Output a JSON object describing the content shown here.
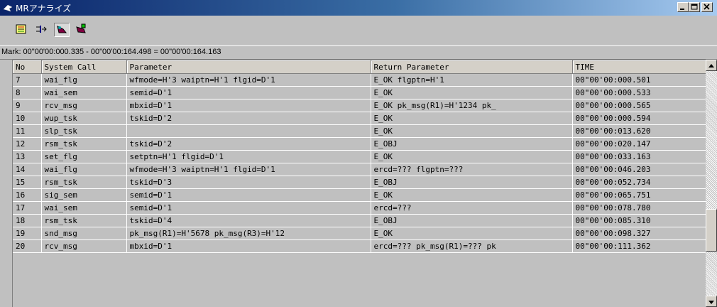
{
  "window": {
    "title": "MRアナライズ"
  },
  "toolbar": {
    "icons": [
      "trace-view-icon",
      "split-view-icon",
      "analyze-icon",
      "settings-icon"
    ]
  },
  "mark": {
    "text": "Mark: 00\"00'00:000.335 - 00\"00'00:164.498 = 00\"00'00:164.163"
  },
  "table": {
    "columns": [
      "No",
      "System Call",
      "Parameter",
      "Return Parameter",
      "TIME"
    ],
    "rows": [
      {
        "no": "7",
        "call": "wai_flg",
        "param": "wfmode=H'3   waiptn=H'1   flgid=D'1",
        "ret": "E_OK   flgptn=H'1",
        "time": "00\"00'00:000.501"
      },
      {
        "no": "8",
        "call": "wai_sem",
        "param": "semid=D'1",
        "ret": "E_OK",
        "time": "00\"00'00:000.533"
      },
      {
        "no": "9",
        "call": "rcv_msg",
        "param": "mbxid=D'1",
        "ret": "E_OK   pk_msg(R1)=H'1234   pk_",
        "time": "00\"00'00:000.565"
      },
      {
        "no": "10",
        "call": "wup_tsk",
        "param": "tskid=D'2",
        "ret": "E_OK",
        "time": "00\"00'00:000.594"
      },
      {
        "no": "11",
        "call": "slp_tsk",
        "param": "",
        "ret": "E_OK",
        "time": "00\"00'00:013.620"
      },
      {
        "no": "12",
        "call": "rsm_tsk",
        "param": "tskid=D'2",
        "ret": "E_OBJ",
        "time": "00\"00'00:020.147"
      },
      {
        "no": "13",
        "call": "set_flg",
        "param": "setptn=H'1   flgid=D'1",
        "ret": "E_OK",
        "time": "00\"00'00:033.163"
      },
      {
        "no": "14",
        "call": "wai_flg",
        "param": "wfmode=H'3   waiptn=H'1   flgid=D'1",
        "ret": "ercd=???   flgptn=???",
        "time": "00\"00'00:046.203"
      },
      {
        "no": "15",
        "call": "rsm_tsk",
        "param": "tskid=D'3",
        "ret": "E_OBJ",
        "time": "00\"00'00:052.734"
      },
      {
        "no": "16",
        "call": "sig_sem",
        "param": "semid=D'1",
        "ret": "E_OK",
        "time": "00\"00'00:065.751"
      },
      {
        "no": "17",
        "call": "wai_sem",
        "param": "semid=D'1",
        "ret": "ercd=???",
        "time": "00\"00'00:078.780"
      },
      {
        "no": "18",
        "call": "rsm_tsk",
        "param": "tskid=D'4",
        "ret": "E_OBJ",
        "time": "00\"00'00:085.310"
      },
      {
        "no": "19",
        "call": "snd_msg",
        "param": "pk_msg(R1)=H'5678   pk_msg(R3)=H'12",
        "ret": "E_OK",
        "time": "00\"00'00:098.327"
      },
      {
        "no": "20",
        "call": "rcv_msg",
        "param": "mbxid=D'1",
        "ret": "ercd=???   pk_msg(R1)=???   pk",
        "time": "00\"00'00:111.362"
      }
    ]
  }
}
